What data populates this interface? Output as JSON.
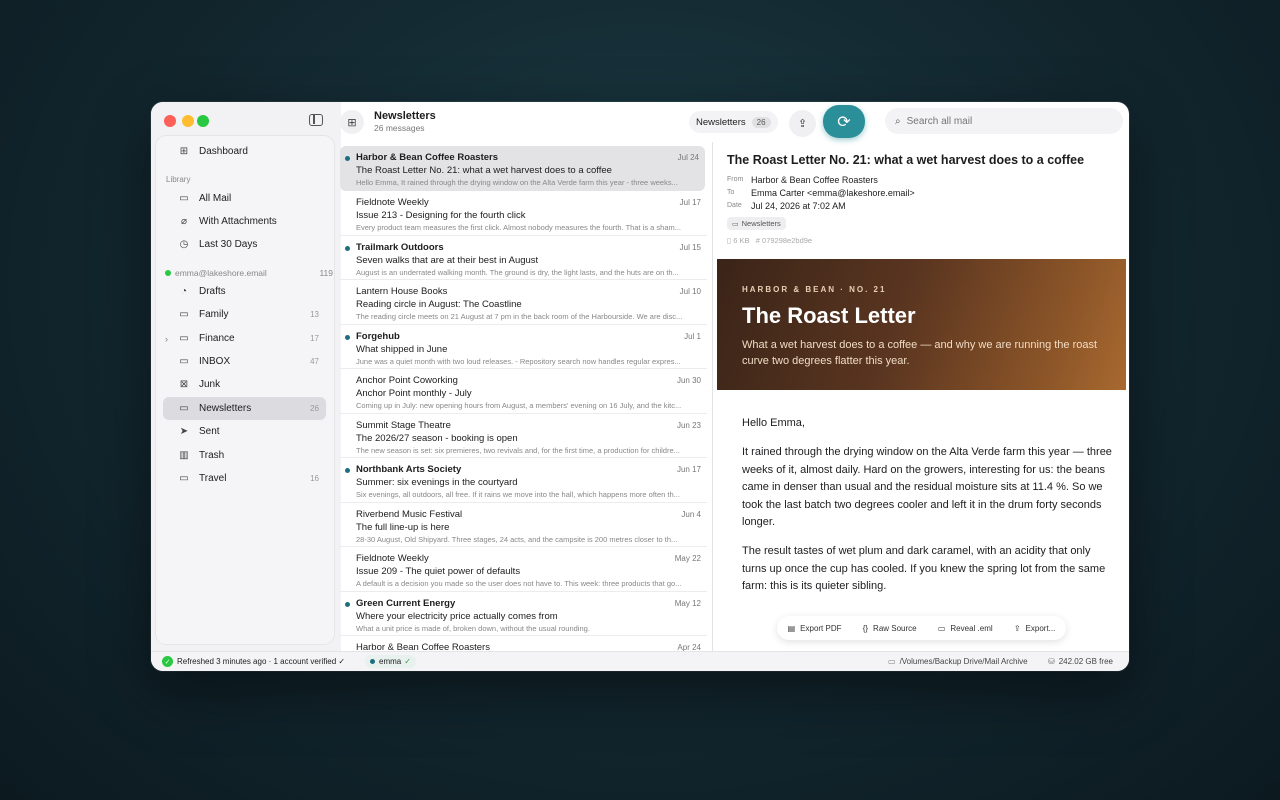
{
  "sidebar": {
    "dashboard": "Dashboard",
    "library_label": "Library",
    "library": [
      {
        "label": "All Mail",
        "icon": "tray-icon"
      },
      {
        "label": "With Attachments",
        "icon": "paperclip-icon"
      },
      {
        "label": "Last 30 Days",
        "icon": "clock-icon"
      }
    ],
    "account": {
      "email": "emma@lakeshore.email",
      "count": "119"
    },
    "folders": [
      {
        "label": "Drafts",
        "count": ""
      },
      {
        "label": "Family",
        "count": "13"
      },
      {
        "label": "Finance",
        "count": "17"
      },
      {
        "label": "INBOX",
        "count": "47"
      },
      {
        "label": "Junk",
        "count": ""
      },
      {
        "label": "Newsletters",
        "count": "26"
      },
      {
        "label": "Sent",
        "count": ""
      },
      {
        "label": "Trash",
        "count": ""
      },
      {
        "label": "Travel",
        "count": "16"
      }
    ]
  },
  "list": {
    "title": "Newsletters",
    "subtitle": "26 messages",
    "messages": [
      {
        "sender": "Harbor & Bean Coffee Roasters",
        "date": "Jul 24",
        "subject": "The Roast Letter No. 21: what a wet harvest does to a coffee",
        "preview": "Hello Emma, It rained through the drying window on the Alta Verde farm this year - three weeks...",
        "unread": true
      },
      {
        "sender": "Fieldnote Weekly",
        "date": "Jul 17",
        "subject": "Issue 213 - Designing for the fourth click",
        "preview": "Every product team measures the first click. Almost nobody measures the fourth. That is a sham...",
        "unread": false
      },
      {
        "sender": "Trailmark Outdoors",
        "date": "Jul 15",
        "subject": "Seven walks that are at their best in August",
        "preview": "August is an underrated walking month. The ground is dry, the light lasts, and the huts are on th...",
        "unread": true
      },
      {
        "sender": "Lantern House Books",
        "date": "Jul 10",
        "subject": "Reading circle in August: The Coastline",
        "preview": "The reading circle meets on 21 August at 7 pm in the back room of the Harbourside. We are disc...",
        "unread": false
      },
      {
        "sender": "Forgehub",
        "date": "Jul 1",
        "subject": "What shipped in June",
        "preview": "June was a quiet month with two loud releases. - Repository search now handles regular expres...",
        "unread": true
      },
      {
        "sender": "Anchor Point Coworking",
        "date": "Jun 30",
        "subject": "Anchor Point monthly - July",
        "preview": "Coming up in July: new opening hours from August, a members' evening on 16 July, and the kitc...",
        "unread": false
      },
      {
        "sender": "Summit Stage Theatre",
        "date": "Jun 23",
        "subject": "The 2026/27 season - booking is open",
        "preview": "The new season is set: six premieres, two revivals and, for the first time, a production for childre...",
        "unread": false
      },
      {
        "sender": "Northbank Arts Society",
        "date": "Jun 17",
        "subject": "Summer: six evenings in the courtyard",
        "preview": "Six evenings, all outdoors, all free. If it rains we move into the hall, which happens more often th...",
        "unread": true
      },
      {
        "sender": "Riverbend Music Festival",
        "date": "Jun 4",
        "subject": "The full line-up is here",
        "preview": "28-30 August, Old Shipyard. Three stages, 24 acts, and the campsite is 200 metres closer to th...",
        "unread": false
      },
      {
        "sender": "Fieldnote Weekly",
        "date": "May 22",
        "subject": "Issue 209 - The quiet power of defaults",
        "preview": "A default is a decision you made so the user does not have to. This week: three products that go...",
        "unread": false
      },
      {
        "sender": "Green Current Energy",
        "date": "May 12",
        "subject": "Where your electricity price actually comes from",
        "preview": "What a unit price is made of, broken down, without the usual rounding.",
        "unread": true
      },
      {
        "sender": "Harbor & Bean Coffee Roasters",
        "date": "Apr 24",
        "subject": "",
        "preview": "",
        "unread": false
      }
    ]
  },
  "toolbar": {
    "folder_pill": "Newsletters",
    "folder_count": "26",
    "search_placeholder": "Search all mail"
  },
  "reader": {
    "subject": "The Roast Letter No. 21: what a wet harvest does to a coffee",
    "from_label": "From",
    "from": "Harbor & Bean Coffee Roasters",
    "to_label": "To",
    "to": "Emma Carter <emma@lakeshore.email>",
    "date_label": "Date",
    "date": "Jul 24, 2026 at 7:02 AM",
    "tag": "Newsletters",
    "size": "6 KB",
    "hash": "079298e2bd9e",
    "hero_kicker": "HARBOR & BEAN · NO. 21",
    "hero_title": "The Roast Letter",
    "hero_sub": "What a wet harvest does to a coffee — and why we are running the roast curve two degrees flatter this year.",
    "greeting": "Hello Emma,",
    "para1": "It rained through the drying window on the Alta Verde farm this year — three weeks of it, almost daily. Hard on the growers, interesting for us: the beans came in denser than usual and the residual moisture sits at 11.4 %. So we took the last batch two degrees cooler and left it in the drum forty seconds longer.",
    "para2": "The result tastes of wet plum and dark caramel, with an acidity that only turns up once the cup has cooled. If you knew the spring lot from the same farm: this is its quieter sibling.",
    "actions": [
      "Export PDF",
      "Raw Source",
      "Reveal .eml",
      "Export..."
    ]
  },
  "status": {
    "refreshed": "Refreshed 3 minutes ago · 1 account verified ✓",
    "account": "emma",
    "path": "/Volumes/Backup Drive/Mail Archive",
    "free": "242.02 GB free"
  },
  "colors": {
    "accent": "#2a8f98",
    "unread_dot": "#1d6f7e",
    "hero_start": "#3a2418",
    "hero_end": "#a8692f"
  }
}
